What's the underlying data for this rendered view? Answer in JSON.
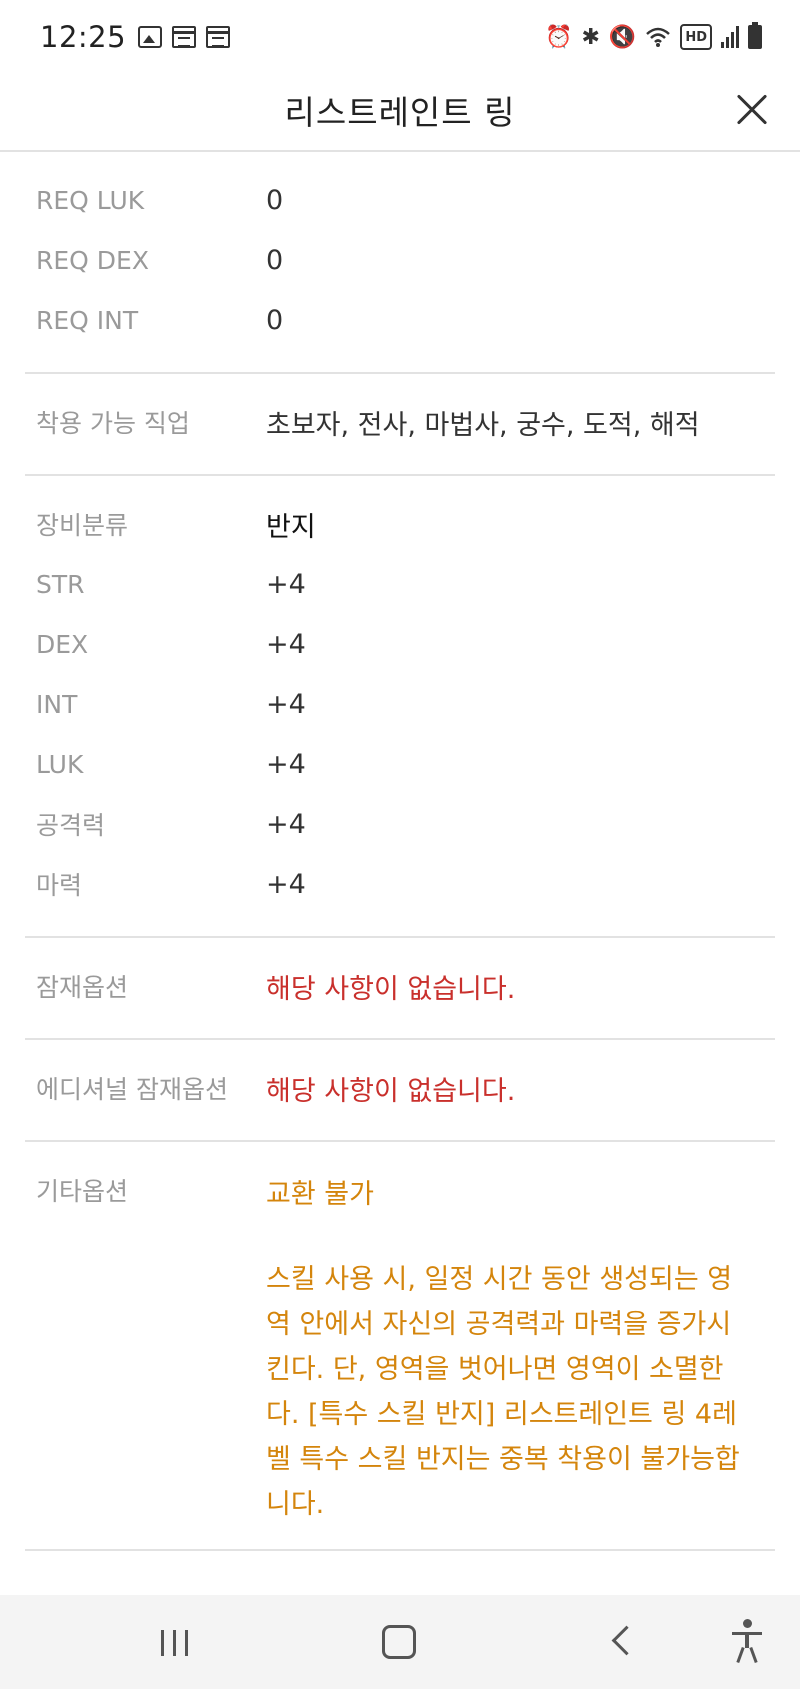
{
  "status_bar": {
    "time": "12:25",
    "left_icons": [
      "image-icon",
      "calendar-icon",
      "calendar-icon"
    ],
    "right_icons": [
      "alarm-icon",
      "bluetooth-icon",
      "mute-icon",
      "wifi-icon",
      "hd-icon",
      "signal-icon",
      "battery-icon"
    ],
    "hd_label": "HD"
  },
  "header": {
    "title": "리스트레인트 링"
  },
  "requirements": [
    {
      "label": "REQ LUK",
      "value": "0"
    },
    {
      "label": "REQ DEX",
      "value": "0"
    },
    {
      "label": "REQ INT",
      "value": "0"
    }
  ],
  "job": {
    "label": "착용 가능 직업",
    "value": "초보자, 전사, 마법사, 궁수, 도적, 해적"
  },
  "stats": [
    {
      "label": "장비분류",
      "value": "반지"
    },
    {
      "label": "STR",
      "value": "+4"
    },
    {
      "label": "DEX",
      "value": "+4"
    },
    {
      "label": "INT",
      "value": "+4"
    },
    {
      "label": "LUK",
      "value": "+4"
    },
    {
      "label": "공격력",
      "value": "+4"
    },
    {
      "label": "마력",
      "value": "+4"
    }
  ],
  "potential": {
    "label": "잠재옵션",
    "value": "해당 사항이 없습니다."
  },
  "additional_potential": {
    "label": "에디셔널 잠재옵션",
    "value": "해당 사항이 없습니다."
  },
  "etc": {
    "label": "기타옵션",
    "line1": "교환 불가",
    "description": "스킬 사용 시, 일정 시간 동안 생성되는 영역 안에서 자신의 공격력과 마력을 증가시킨다. 단, 영역을 벗어나면 영역이 소멸한다. [특수 스킬 반지] 리스트레인트 링 4레벨 특수 스킬 반지는 중복 착용이 불가능합니다."
  },
  "colors": {
    "red": "#c9302c",
    "orange": "#d4850c",
    "label_gray": "#9a9a9a"
  }
}
